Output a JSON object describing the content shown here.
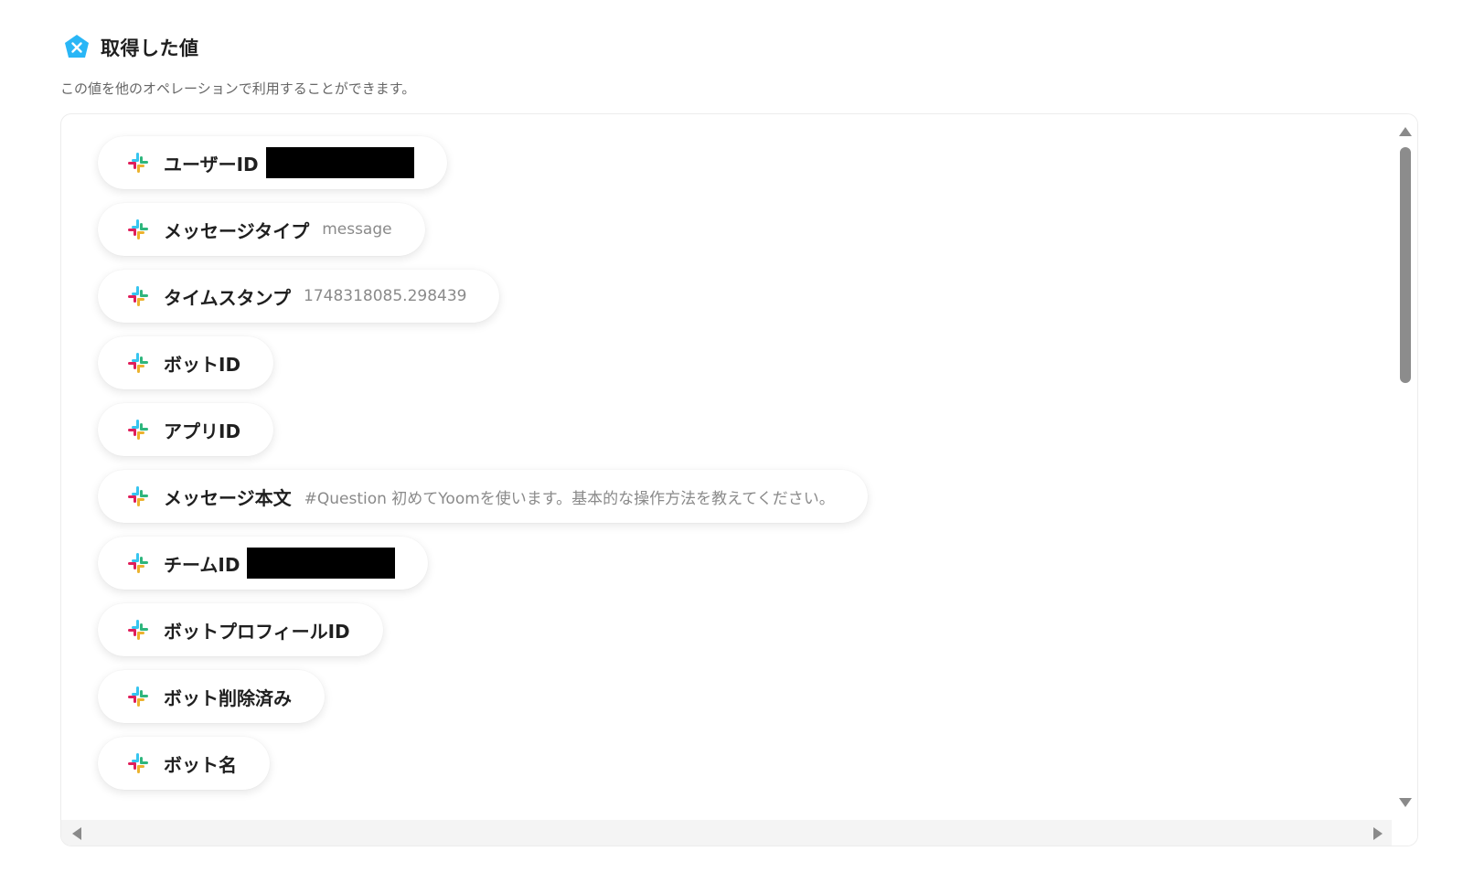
{
  "header": {
    "icon": "yoom-x-icon",
    "icon_color": "#29b6f6",
    "title": "取得した値",
    "description": "この値を他のオペレーションで利用することができます。"
  },
  "fields": [
    {
      "icon": "slack-icon",
      "label": "ユーザーID",
      "value": "",
      "redacted": true
    },
    {
      "icon": "slack-icon",
      "label": "メッセージタイプ",
      "value": "message",
      "redacted": false
    },
    {
      "icon": "slack-icon",
      "label": "タイムスタンプ",
      "value": "1748318085.298439",
      "redacted": false
    },
    {
      "icon": "slack-icon",
      "label": "ボットID",
      "value": "",
      "redacted": false
    },
    {
      "icon": "slack-icon",
      "label": "アプリID",
      "value": "",
      "redacted": false
    },
    {
      "icon": "slack-icon",
      "label": "メッセージ本文",
      "value": "#Question 初めてYoomを使います。基本的な操作方法を教えてください。",
      "redacted": false
    },
    {
      "icon": "slack-icon",
      "label": "チームID",
      "value": "",
      "redacted": true
    },
    {
      "icon": "slack-icon",
      "label": "ボットプロフィールID",
      "value": "",
      "redacted": false
    },
    {
      "icon": "slack-icon",
      "label": "ボット削除済み",
      "value": "",
      "redacted": false
    },
    {
      "icon": "slack-icon",
      "label": "ボット名",
      "value": "",
      "redacted": false
    }
  ],
  "colors": {
    "slack_blue": "#36c5f0",
    "slack_green": "#2eb67d",
    "slack_yellow": "#ecb22e",
    "slack_red": "#e01e5a",
    "scrollbar_thumb": "#8c8c8c"
  }
}
